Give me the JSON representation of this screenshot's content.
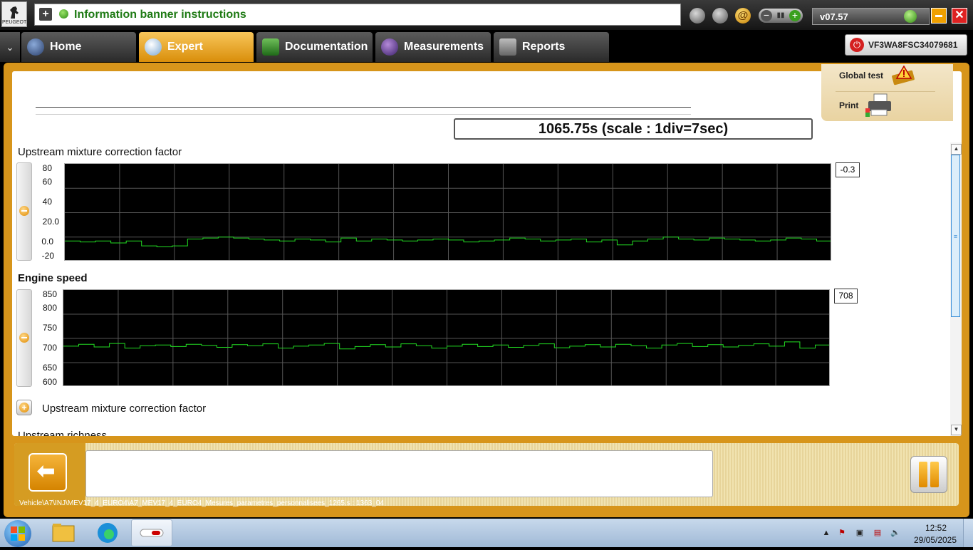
{
  "banner": {
    "text": "Information banner instructions"
  },
  "logo": {
    "text": "PEUGEOT"
  },
  "version": "v07.57",
  "nav": {
    "menu_icon": "chevron-down-icon",
    "tabs": [
      {
        "label": "Home",
        "icon": "home-icon",
        "active": false
      },
      {
        "label": "Expert",
        "icon": "magnifier-icon",
        "active": true
      },
      {
        "label": "Documentation",
        "icon": "book-icon",
        "active": false
      },
      {
        "label": "Measurements",
        "icon": "waveform-icon",
        "active": false
      },
      {
        "label": "Reports",
        "icon": "document-icon",
        "active": false
      }
    ]
  },
  "vin": "VF3WA8FSC34079681",
  "side_panel": {
    "global_test": "Global test",
    "print": "Print"
  },
  "time_display": "1065.75s (scale : 1div=7sec)",
  "params": [
    {
      "title": "Upstream mixture correction factor",
      "bold": false,
      "y_ticks": [
        "80",
        "60",
        "40",
        "20.0",
        "0.0",
        "-20"
      ],
      "current_value": "-0.3",
      "y_range": [
        -20,
        80
      ]
    },
    {
      "title": "Engine speed",
      "bold": true,
      "y_ticks": [
        "850",
        "800",
        "750",
        "700",
        "650",
        "600"
      ],
      "current_value": "708",
      "y_range": [
        600,
        850
      ]
    }
  ],
  "collapsed_param": "Upstream mixture correction factor",
  "next_param": "Upstream richness",
  "path": "Vehicle\\A7\\INJ\\MEV17_4_EURO4\\A7_MEV17_4_EURO4_Mesures_parametres_personnalisees_1265.s : 1363_04",
  "taskbar": {
    "time": "12:52",
    "date": "29/05/2025"
  },
  "colors": {
    "accent": "#d7951b",
    "trace": "#22dd22",
    "banner_text": "#1e7a14"
  },
  "chart_data": [
    {
      "type": "line",
      "title": "Upstream mixture correction factor",
      "ylim": [
        -20,
        80
      ],
      "grid": true,
      "series": [
        {
          "name": "",
          "values": [
            1,
            0,
            1,
            -1,
            1,
            -4,
            -5,
            -4,
            3,
            4,
            5,
            4,
            3,
            2,
            1,
            3,
            2,
            0,
            4,
            1,
            3,
            2,
            1,
            2,
            3,
            2,
            0,
            1,
            2,
            4,
            3,
            1,
            2,
            3,
            0,
            2,
            -3,
            1,
            3,
            5,
            3,
            2,
            4,
            3,
            2,
            1,
            2,
            4,
            3,
            1
          ]
        }
      ]
    },
    {
      "type": "line",
      "title": "Engine speed",
      "ylim": [
        600,
        850
      ],
      "grid": true,
      "series": [
        {
          "name": "",
          "values": [
            705,
            710,
            703,
            712,
            700,
            706,
            708,
            704,
            710,
            707,
            702,
            709,
            706,
            711,
            700,
            705,
            708,
            712,
            698,
            704,
            709,
            703,
            711,
            706,
            700,
            705,
            710,
            704,
            708,
            702,
            707,
            711,
            701,
            705,
            709,
            703,
            710,
            706,
            700,
            708,
            712,
            704,
            709,
            703,
            707,
            711,
            705,
            716,
            700,
            708
          ]
        }
      ]
    }
  ]
}
